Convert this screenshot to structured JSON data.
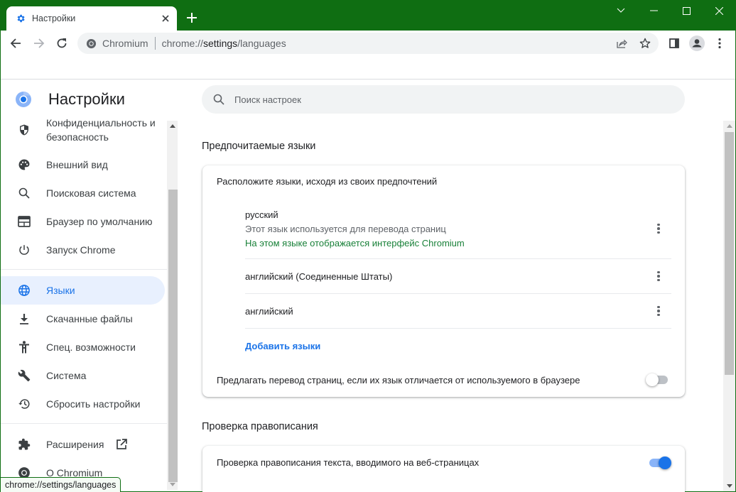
{
  "window": {
    "frame_color": "#0f6e12",
    "tab": {
      "title": "Настройки",
      "icon": "gear-icon"
    },
    "controls": [
      "tab-search",
      "minimize",
      "maximize",
      "close"
    ]
  },
  "toolbar": {
    "site_label": "Chromium",
    "url_scheme": "chrome://",
    "url_host": "settings",
    "url_path": "/languages"
  },
  "page": {
    "title": "Настройки",
    "search_placeholder": "Поиск настроек",
    "accent_color": "#1a73e8"
  },
  "sidebar": {
    "items": [
      {
        "label_line1": "Конфиденциальность и",
        "label_line2": "безопасность",
        "icon": "shield-icon"
      },
      {
        "label": "Внешний вид",
        "icon": "palette-icon"
      },
      {
        "label": "Поисковая система",
        "icon": "search-icon"
      },
      {
        "label": "Браузер по умолчанию",
        "icon": "browser-window-icon"
      },
      {
        "label": "Запуск Chrome",
        "icon": "power-icon"
      },
      {
        "label": "Языки",
        "icon": "globe-icon",
        "active": true
      },
      {
        "label": "Скачанные файлы",
        "icon": "download-icon"
      },
      {
        "label": "Спец. возможности",
        "icon": "accessibility-icon"
      },
      {
        "label": "Система",
        "icon": "wrench-icon"
      },
      {
        "label": "Сбросить настройки",
        "icon": "restore-icon"
      },
      {
        "label": "Расширения",
        "icon": "puzzle-icon"
      },
      {
        "label": "О Chromium",
        "icon": "chromium-icon"
      }
    ]
  },
  "languages": {
    "section_title": "Предпочитаемые языки",
    "card_heading": "Расположите языки, исходя из своих предпочтений",
    "list": [
      {
        "name": "русский",
        "sub": "Этот язык используется для перевода страниц",
        "ui_note": "На этом языке отображается интерфейс Chromium"
      },
      {
        "name": "английский (Соединенные Штаты)"
      },
      {
        "name": "английский"
      }
    ],
    "add_label": "Добавить языки",
    "offer_translate_label": "Предлагать перевод страниц, если их язык отличается от используемого в браузере",
    "offer_translate_on": false
  },
  "spellcheck": {
    "section_title": "Проверка правописания",
    "toggle_label": "Проверка правописания текста, вводимого на веб-страницах",
    "enabled": true
  },
  "status_bar": {
    "text": "chrome://settings/languages"
  }
}
